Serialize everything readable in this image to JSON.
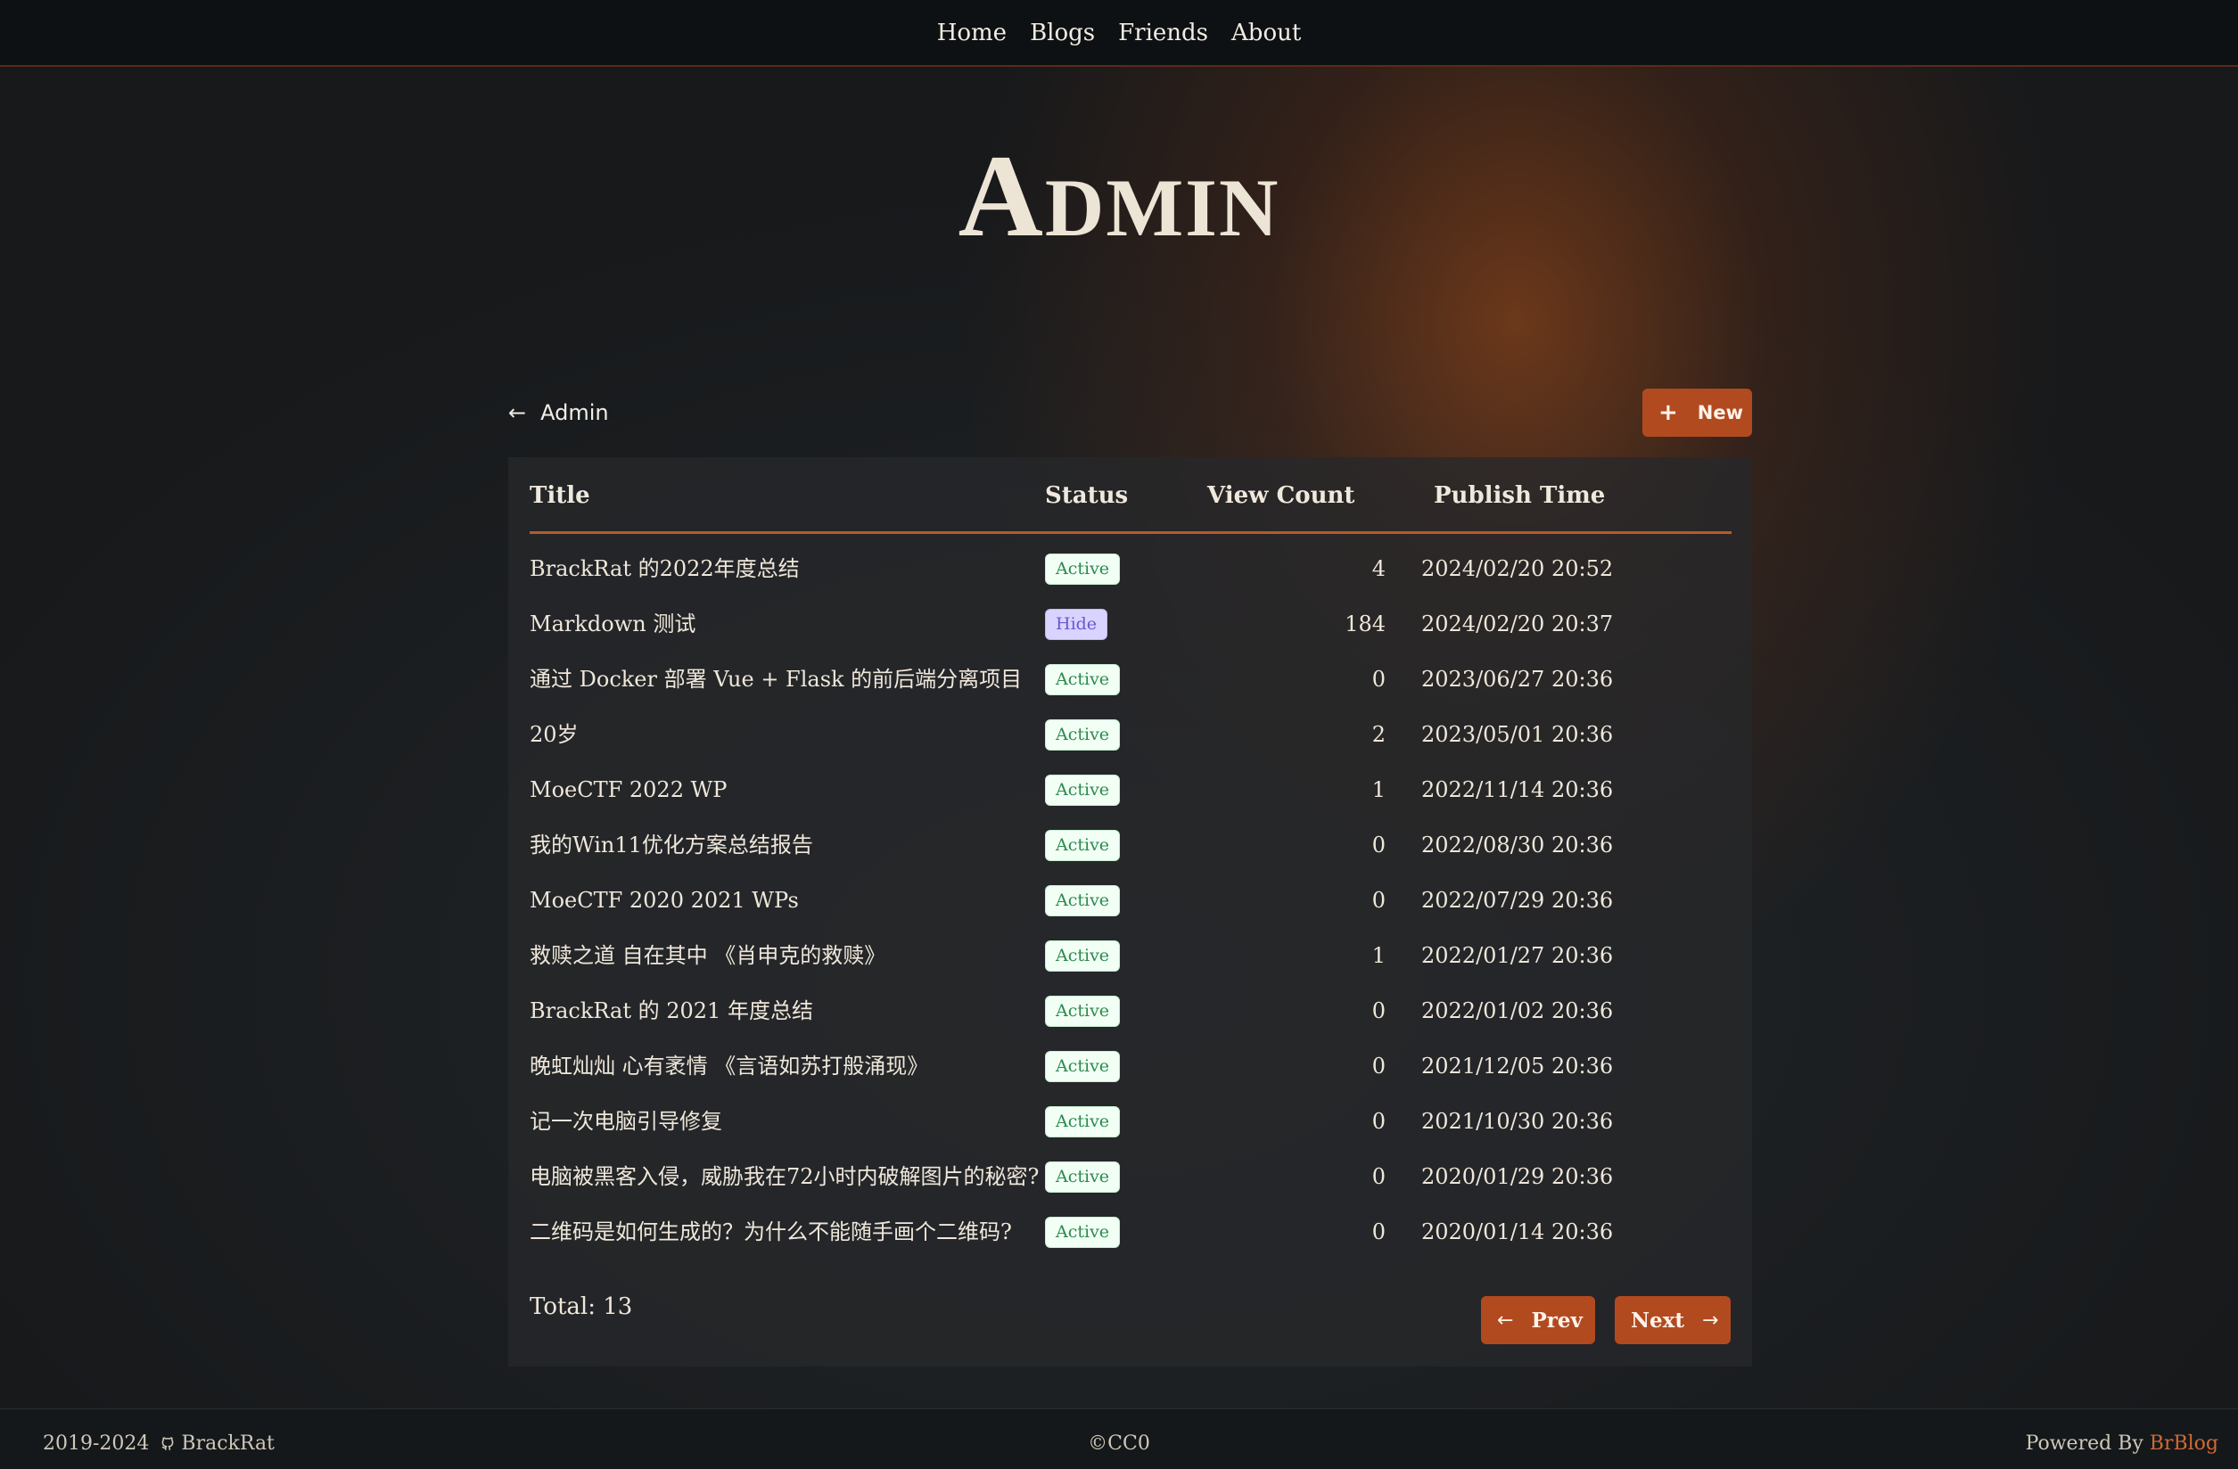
{
  "nav": {
    "items": [
      "Home",
      "Blogs",
      "Friends",
      "About"
    ]
  },
  "hero": {
    "title": "Admin"
  },
  "section": {
    "back_arrow": "←",
    "back_label": "Admin",
    "new_icon": "+",
    "new_label": "New"
  },
  "table": {
    "headers": {
      "title": "Title",
      "status": "Status",
      "views": "View Count",
      "time": "Publish Time"
    },
    "rows": [
      {
        "title": "BrackRat 的2022年度总结",
        "status": "Active",
        "views": "4",
        "time": "2024/02/20 20:52"
      },
      {
        "title": "Markdown 测试",
        "status": "Hide",
        "views": "184",
        "time": "2024/02/20 20:37"
      },
      {
        "title": "通过 Docker 部署 Vue + Flask 的前后端分离项目",
        "status": "Active",
        "views": "0",
        "time": "2023/06/27 20:36"
      },
      {
        "title": "20岁",
        "status": "Active",
        "views": "2",
        "time": "2023/05/01 20:36"
      },
      {
        "title": "MoeCTF 2022 WP",
        "status": "Active",
        "views": "1",
        "time": "2022/11/14 20:36"
      },
      {
        "title": "我的Win11优化方案总结报告",
        "status": "Active",
        "views": "0",
        "time": "2022/08/30 20:36"
      },
      {
        "title": "MoeCTF 2020 2021 WPs",
        "status": "Active",
        "views": "0",
        "time": "2022/07/29 20:36"
      },
      {
        "title": "救赎之道 自在其中 《肖申克的救赎》",
        "status": "Active",
        "views": "1",
        "time": "2022/01/27 20:36"
      },
      {
        "title": "BrackRat 的 2021 年度总结",
        "status": "Active",
        "views": "0",
        "time": "2022/01/02 20:36"
      },
      {
        "title": "晚虹灿灿 心有袤情 《言语如苏打般涌现》",
        "status": "Active",
        "views": "0",
        "time": "2021/12/05 20:36"
      },
      {
        "title": "记一次电脑引导修复",
        "status": "Active",
        "views": "0",
        "time": "2021/10/30 20:36"
      },
      {
        "title": "电脑被黑客入侵，威胁我在72小时内破解图片的秘密?",
        "status": "Active",
        "views": "0",
        "time": "2020/01/29 20:36"
      },
      {
        "title": "二维码是如何生成的？为什么不能随手画个二维码?",
        "status": "Active",
        "views": "0",
        "time": "2020/01/14 20:36"
      }
    ],
    "total_label": "Total: 13"
  },
  "pagination": {
    "prev_arrow": "←",
    "prev_label": "Prev",
    "next_label": "Next",
    "next_arrow": "→"
  },
  "footer": {
    "years": "2019-2024",
    "author": "BrackRat",
    "license": "©CC0",
    "powered_prefix": "Powered By",
    "powered_link": "BrBlog"
  },
  "colors": {
    "accent": "#b24a1f",
    "active_badge": "#2c8a4c",
    "hide_badge": "#6a56d0"
  },
  "icons": {
    "back": "arrow-left-icon",
    "new": "plus-icon",
    "prev": "arrow-left-icon",
    "next": "arrow-right-icon",
    "author": "github-icon"
  }
}
